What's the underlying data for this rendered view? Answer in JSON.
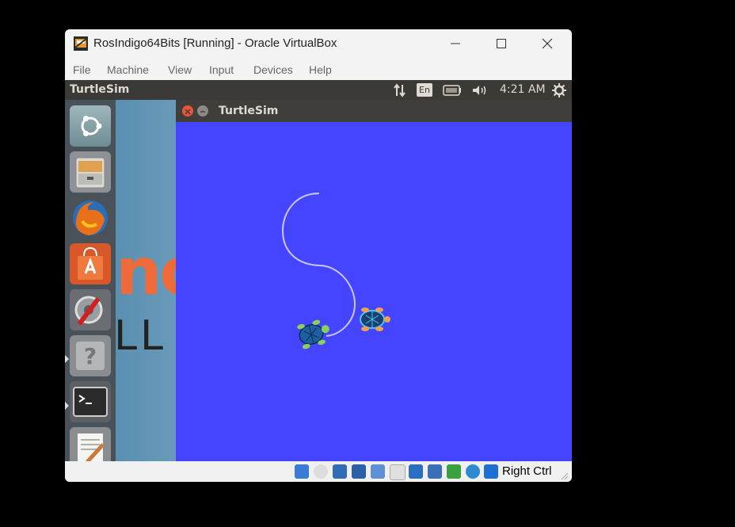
{
  "window": {
    "title": "RosIndigo64Bits [Running] - Oracle VirtualBox"
  },
  "menu": [
    "File",
    "Machine",
    "View",
    "Input",
    "Devices",
    "Help"
  ],
  "guest": {
    "panel_title": "TurtleSim",
    "keyboard_layout": "En",
    "clock": "4:21 AM",
    "wallpaper_big": "no",
    "wallpaper_small": "LL A"
  },
  "launcher": {
    "items": [
      "dash-home",
      "files",
      "firefox",
      "software-center",
      "system-settings",
      "help",
      "terminal",
      "text-editor"
    ]
  },
  "turtlesim": {
    "title": "TurtleSim",
    "background_color": "#4545ff",
    "trail_color": "#c8c8ff"
  },
  "statusbar": {
    "host_key": "Right Ctrl"
  }
}
